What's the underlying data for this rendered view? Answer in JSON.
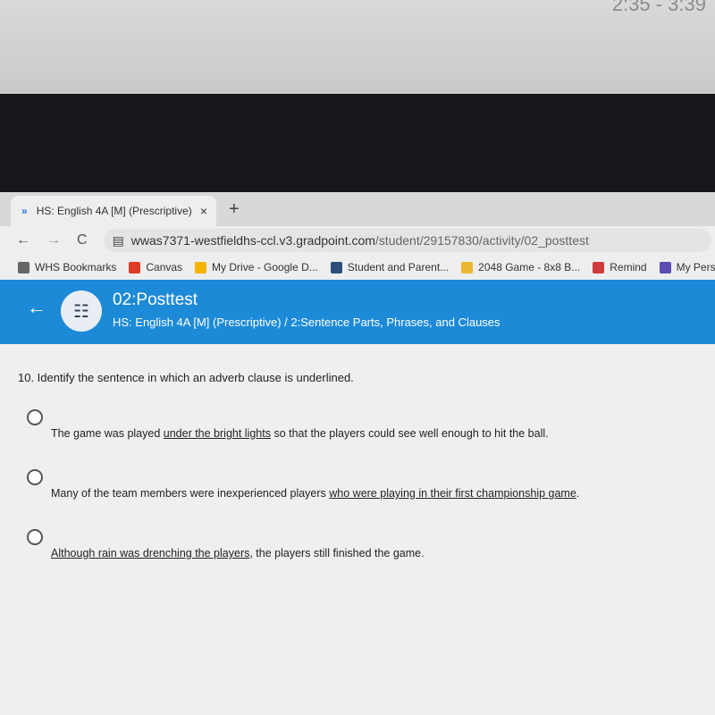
{
  "photo_note": "2:35 - 3:39",
  "browser": {
    "tab_title": "HS: English 4A [M] (Prescriptive)",
    "tab_close": "×",
    "new_tab": "+",
    "url_host": "wwas7371-westfieldhs-ccl.v3.gradpoint.com",
    "url_path": "/student/29157830/activity/02_posttest",
    "bookmarks": [
      {
        "label": "WHS Bookmarks",
        "icon": "folder-icon",
        "color": "#666666"
      },
      {
        "label": "Canvas",
        "icon": "canvas-icon",
        "color": "#e03b24"
      },
      {
        "label": "My Drive - Google D...",
        "icon": "google-drive-icon",
        "color": "#f4b400"
      },
      {
        "label": "Student and Parent...",
        "icon": "sis-icon",
        "color": "#2b4f7a"
      },
      {
        "label": "2048 Game - 8x8 B...",
        "icon": "2048-icon",
        "color": "#e8b830"
      },
      {
        "label": "Remind",
        "icon": "remind-icon",
        "color": "#d03a3a"
      },
      {
        "label": "My Persona",
        "icon": "forms-icon",
        "color": "#5c4bb0"
      }
    ]
  },
  "header": {
    "title": "02:Posttest",
    "subtitle": "HS: English 4A [M] (Prescriptive) / 2:Sentence Parts, Phrases, and Clauses",
    "color": "#1d8ad8"
  },
  "question": {
    "text": "10. Identify the sentence in which an adverb clause is underlined.",
    "options": [
      {
        "before": "The game was played ",
        "underlined": "under the bright lights",
        "after": " so that the players could see well enough to hit the ball.",
        "selected": false
      },
      {
        "before": "Many of the team members were inexperienced players ",
        "underlined": "who were playing in their first championship game",
        "after": ".",
        "selected": false
      },
      {
        "before": "",
        "underlined": "Although rain was drenching the players",
        "after": ", the players still finished the game.",
        "selected": false
      }
    ]
  }
}
